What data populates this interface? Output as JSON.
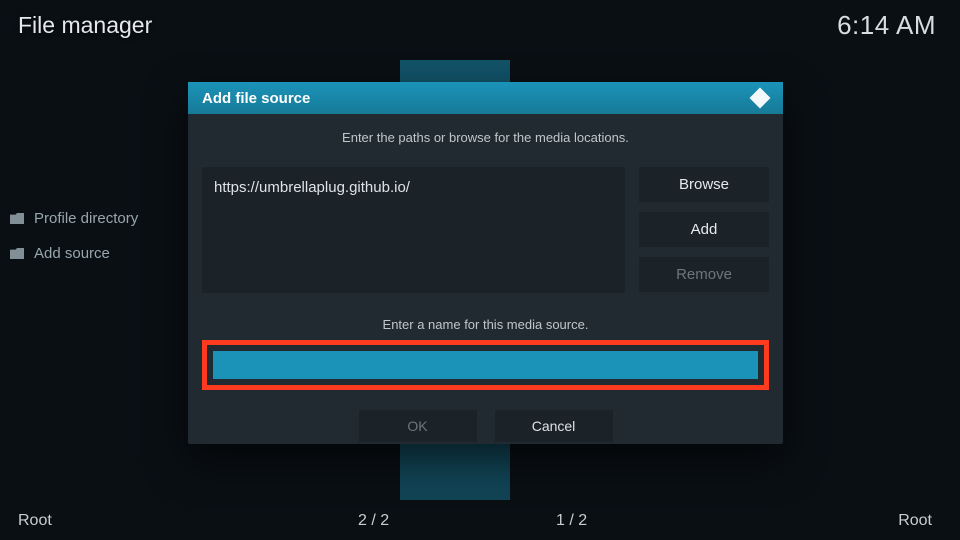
{
  "header": {
    "title": "File manager",
    "clock": "6:14 AM"
  },
  "sidebar": {
    "items": [
      {
        "label": "Profile directory"
      },
      {
        "label": "Add source"
      }
    ]
  },
  "bottom": {
    "leftRoot": "Root",
    "rightRoot": "Root",
    "leftCount": "2 / 2",
    "rightCount": "1 / 2"
  },
  "dialog": {
    "title": "Add file source",
    "instr1": "Enter the paths or browse for the media locations.",
    "path": "https://umbrellaplug.github.io/",
    "browse": "Browse",
    "add": "Add",
    "remove": "Remove",
    "instr2": "Enter a name for this media source.",
    "name": "",
    "ok": "OK",
    "cancel": "Cancel"
  }
}
